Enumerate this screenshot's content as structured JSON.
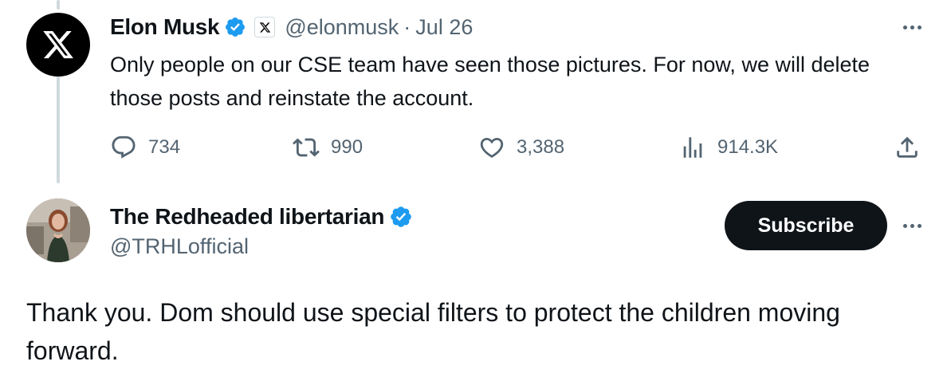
{
  "tweet1": {
    "display_name": "Elon Musk",
    "handle": "@elonmusk",
    "separator": "·",
    "date": "Jul 26",
    "avatar_icon": "x-logo-icon",
    "text": "Only people on our CSE team have seen those pictures. For now, we will delete those posts and reinstate the account.",
    "stats": {
      "replies": "734",
      "reposts": "990",
      "likes": "3,388",
      "views": "914.3K"
    }
  },
  "tweet2": {
    "display_name": "The Redheaded libertarian",
    "handle": "@TRHLofficial",
    "subscribe_label": "Subscribe",
    "text": "Thank you. Dom should use special filters to protect the children moving forward."
  },
  "colors": {
    "verified_blue": "#1d9bf0",
    "secondary_text": "#536471",
    "primary_text": "#0f1419",
    "thread_line": "#cfd9de"
  }
}
